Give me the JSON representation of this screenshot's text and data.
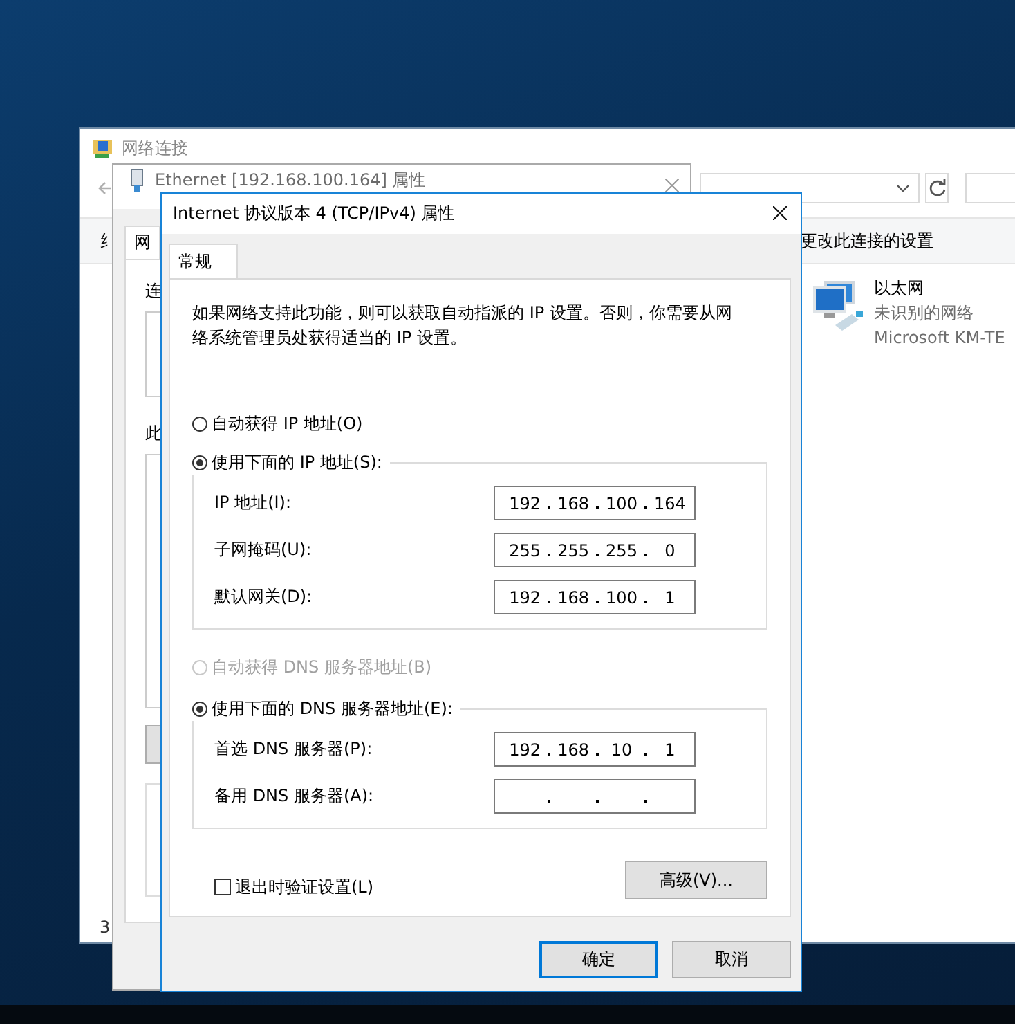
{
  "back_window": {
    "title": "网络连接",
    "nav_fragment": "纟",
    "toolbar_action": "更改此连接的设置",
    "adapter": {
      "name": "以太网",
      "status": "未识别的网络",
      "device": "Microsoft KM-TE"
    },
    "status_bar": "3"
  },
  "middle_window": {
    "title": "Ethernet [192.168.100.164] 属性",
    "tab": "网",
    "label_1": "连",
    "label_2": "此"
  },
  "dialog": {
    "title": "Internet 协议版本 4 (TCP/IPv4) 属性",
    "tabs": [
      {
        "label": "常规",
        "selected": true
      }
    ],
    "description": "如果网络支持此功能，则可以获取自动指派的 IP 设置。否则，你需要从网络系统管理员处获得适当的 IP 设置。",
    "ip_options": [
      {
        "label": "自动获得 IP 地址(O)",
        "selected": false,
        "disabled": false
      },
      {
        "label": "使用下面的 IP 地址(S):",
        "selected": true,
        "disabled": false
      }
    ],
    "ip_fields": [
      {
        "label": "IP 地址(I):",
        "octets": [
          "192",
          "168",
          "100",
          "164"
        ]
      },
      {
        "label": "子网掩码(U):",
        "octets": [
          "255",
          "255",
          "255",
          "0"
        ]
      },
      {
        "label": "默认网关(D):",
        "octets": [
          "192",
          "168",
          "100",
          "1"
        ]
      }
    ],
    "dns_options": [
      {
        "label": "自动获得 DNS 服务器地址(B)",
        "selected": false,
        "disabled": true
      },
      {
        "label": "使用下面的 DNS 服务器地址(E):",
        "selected": true,
        "disabled": false
      }
    ],
    "dns_fields": [
      {
        "label": "首选 DNS 服务器(P):",
        "octets": [
          "192",
          "168",
          "10",
          "1"
        ]
      },
      {
        "label": "备用 DNS 服务器(A):"
      }
    ],
    "validate_checkbox": {
      "label": "退出时验证设置(L)",
      "checked": false
    },
    "advanced_button": "高级(V)...",
    "buttons": [
      {
        "label": "确定",
        "default": true
      },
      {
        "label": "取消",
        "default": false
      }
    ]
  }
}
